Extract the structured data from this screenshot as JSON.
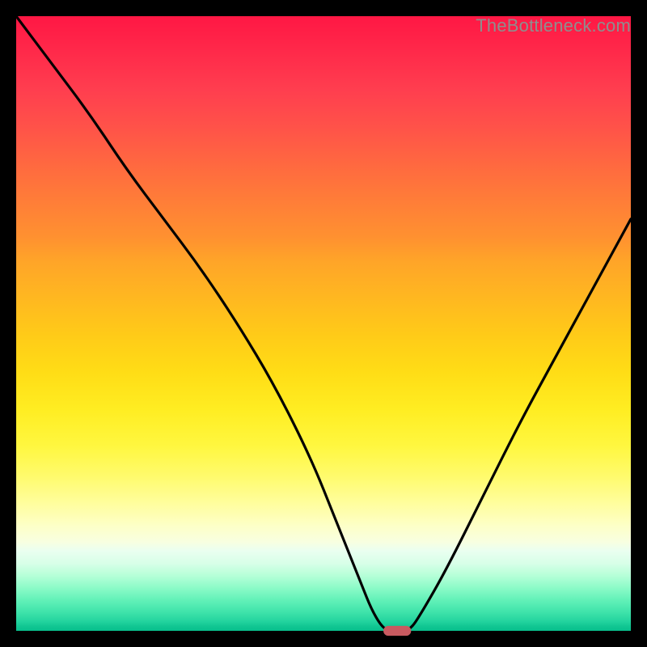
{
  "watermark": "TheBottleneck.com",
  "chart_data": {
    "type": "line",
    "title": "",
    "xlabel": "",
    "ylabel": "",
    "xlim": [
      0,
      100
    ],
    "ylim": [
      0,
      100
    ],
    "grid": false,
    "legend": false,
    "series": [
      {
        "name": "bottleneck-curve",
        "x": [
          0,
          6,
          12,
          18,
          24,
          30,
          36,
          42,
          48,
          52,
          56,
          58,
          60,
          62,
          64,
          66,
          70,
          76,
          82,
          88,
          94,
          100
        ],
        "y": [
          100,
          92,
          84,
          75,
          67,
          59,
          50,
          40,
          28,
          18,
          8,
          3,
          0,
          0,
          0,
          3,
          10,
          22,
          34,
          45,
          56,
          67
        ]
      }
    ],
    "marker": {
      "x": 62,
      "y": 0,
      "width_pct": 4.5,
      "height_pct": 1.6,
      "color": "#c85a60"
    },
    "gradient_stops": [
      {
        "pct": 0,
        "color": "#ff1744"
      },
      {
        "pct": 50,
        "color": "#ffcb18"
      },
      {
        "pct": 82,
        "color": "#fffea0"
      },
      {
        "pct": 100,
        "color": "#08bf8d"
      }
    ]
  }
}
